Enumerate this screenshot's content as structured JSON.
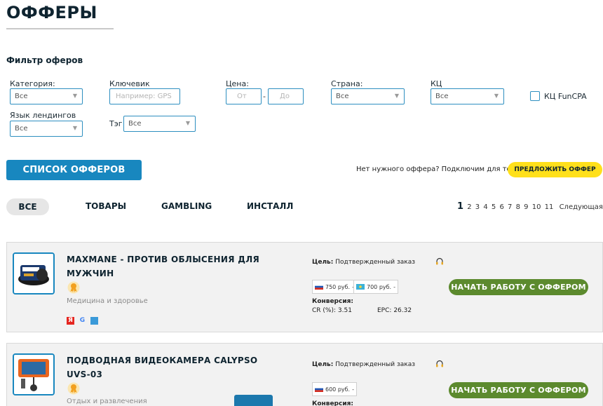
{
  "page": {
    "title": "ОФФЕРЫ"
  },
  "filters": {
    "title": "Фильтр оферов",
    "category": {
      "label": "Категория:",
      "value": "Все"
    },
    "keyword": {
      "label": "Ключевик",
      "placeholder": "Например: GPS"
    },
    "price": {
      "label": "Цена:",
      "from_placeholder": "От",
      "to_placeholder": "До",
      "separator": "-"
    },
    "country": {
      "label": "Страна:",
      "value": "Все"
    },
    "kc": {
      "label": "КЦ",
      "value": "Все"
    },
    "kc_funcpa": {
      "label": "КЦ FunCPA",
      "checked": false
    },
    "landing_lang": {
      "label": "Язык лендингов",
      "value": "Все"
    },
    "tag": {
      "label": "Тэг",
      "value": "Все"
    },
    "chevron": "▼"
  },
  "actions": {
    "list_button": "СПИСОК ОФФЕРОВ",
    "no_offer_text": "Нет нужного оффера? Подключим для тебя",
    "suggest_button": "ПРЕДЛОЖИТЬ ОФФЕР"
  },
  "tabs": [
    "ВСЕ",
    "ТОВАРЫ",
    "GAMBLING",
    "ИНСТАЛЛ"
  ],
  "pagination": {
    "current": "1",
    "pages": [
      "2",
      "3",
      "4",
      "5",
      "6",
      "7",
      "8",
      "9",
      "10",
      "11"
    ],
    "next_label": "Следующая",
    "arrow": ">"
  },
  "offers": [
    {
      "name": "MAXMANE - ПРОТИВ ОБЛЫСЕНИЯ ДЛЯ МУЖЧИН",
      "category": "Медицина и здоровье",
      "goal_label": "Цель:",
      "goal_value": "Подтвержденный заказ",
      "prices": [
        {
          "flag": "ru",
          "amount": "750 руб.",
          "suffix": "-"
        },
        {
          "flag": "kz",
          "amount": "700 руб.",
          "suffix": "-"
        }
      ],
      "conversion_label": "Конверсия:",
      "cr_label": "CR (%):",
      "cr_value": "3.51",
      "epc_label": "EPC:",
      "epc_value": "26.32",
      "sources": [
        "yandex-icon",
        "google-icon",
        "facebook-icon"
      ],
      "source_glyphs": [
        "Я",
        "G",
        ""
      ],
      "start_button": "НАЧАТЬ РАБОТУ С ОФФЕРОМ"
    },
    {
      "name": "ПОДВОДНАЯ ВИДЕОКАМЕРА CALYPSO UVS-03",
      "category": "Отдых и развлечения",
      "goal_label": "Цель:",
      "goal_value": "Подтвержденный заказ",
      "prices": [
        {
          "flag": "ru",
          "amount": "600 руб.",
          "suffix": "-"
        }
      ],
      "conversion_label": "Конверсия:",
      "start_button": "НАЧАТЬ РАБОТУ С ОФФЕРОМ"
    }
  ],
  "colors": {
    "accent_blue": "#1887bf",
    "cta_green": "#5c8a2e",
    "cta_yellow": "#ffe01b",
    "title_dark": "#0f2430"
  }
}
